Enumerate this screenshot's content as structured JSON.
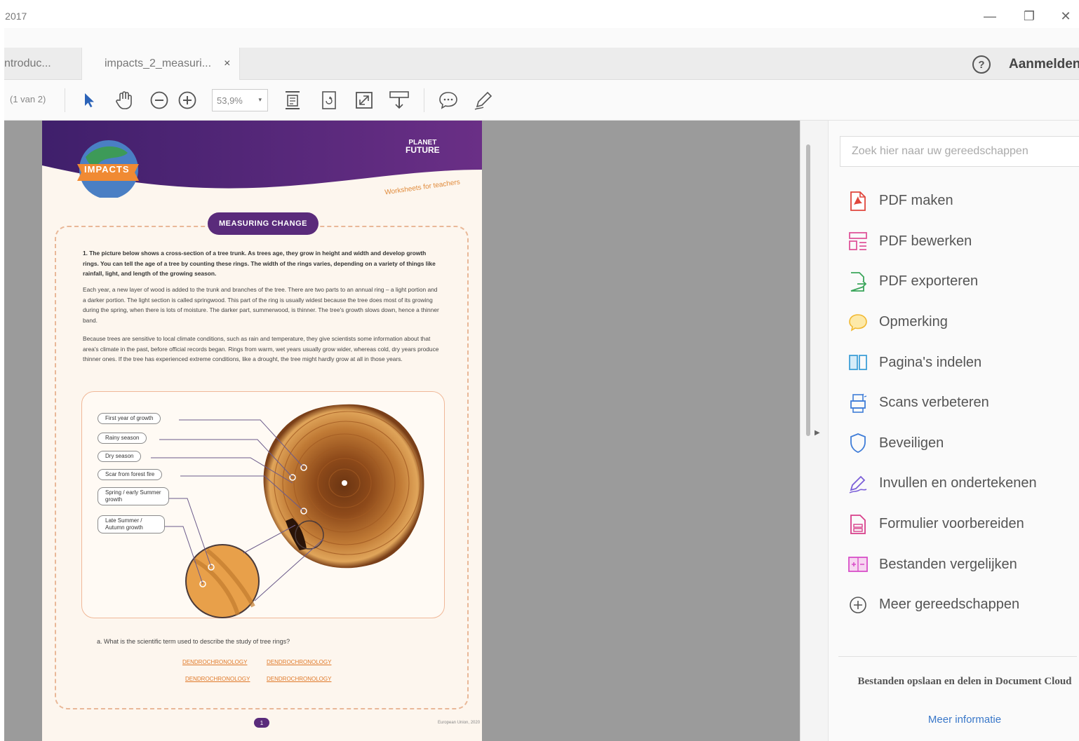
{
  "window": {
    "title": " 2017",
    "minimize": "—",
    "restore": "❐",
    "close": "✕"
  },
  "tabs": [
    {
      "label": "ntroduc..."
    },
    {
      "label": "impacts_2_measuri...",
      "close": "×"
    }
  ],
  "header": {
    "help": "?",
    "signin": "Aanmelden"
  },
  "toolbar": {
    "page_indicator": "(1 van 2)",
    "zoom": "53,9%",
    "zoom_caret": "▾"
  },
  "document": {
    "banner_label": "IMPACTS",
    "logo_line1": "PLANET",
    "logo_line2": "FUTURE",
    "worksheets_label": "Worksheets for teachers",
    "section_title": "MEASURING CHANGE",
    "paragraph1": "1. The picture below shows a cross-section of a tree trunk. As trees age, they grow in height and width and develop growth rings. You can tell the age of a tree by counting these rings. The width of the rings varies, depending on a variety of things like rainfall, light, and length of the growing season.",
    "paragraph2": "Each year, a new layer of wood is added to the trunk and branches of the tree. There are two parts to an annual ring – a light portion and a darker portion. The light section is called springwood. This part of the ring is usually widest because the tree does most of its growing during the spring, when there is lots of moisture. The darker part, summerwood, is thinner. The tree's growth slows down, hence a thinner band.",
    "paragraph3": "Because trees are sensitive to local climate conditions, such as rain and temperature, they give scientists some information about that area's climate in the past, before official records began. Rings from warm, wet years usually grow wider, whereas cold, dry years produce thinner ones. If the tree has experienced extreme conditions, like a drought, the tree might hardly grow at all in those years.",
    "labels": [
      "First year of growth",
      "Rainy season",
      "Dry season",
      "Scar from forest fire",
      "Spring / early Summer growth",
      "Late Summer / Autumn growth"
    ],
    "question": "a. What is the scientific term used to describe the study of tree rings?",
    "answers": [
      "DENDROCHRONOLOGY",
      "DENDROCHRONOLOGY",
      "DENDROCHRONOLOGY",
      "DENDROCHRONOLOGY"
    ],
    "page_number": "1",
    "footer": "European Union, 2020"
  },
  "rightpane": {
    "search_placeholder": "Zoek hier naar uw gereedschappen",
    "tools": [
      {
        "label": "PDF maken",
        "icon": "pdf-create-icon",
        "color": "#e0463c"
      },
      {
        "label": "PDF bewerken",
        "icon": "pdf-edit-icon",
        "color": "#e0559a"
      },
      {
        "label": "PDF exporteren",
        "icon": "pdf-export-icon",
        "color": "#3aa55a"
      },
      {
        "label": "Opmerking",
        "icon": "comment-icon",
        "color": "#f1b830"
      },
      {
        "label": "Pagina's indelen",
        "icon": "organize-pages-icon",
        "color": "#3fa0d8"
      },
      {
        "label": "Scans verbeteren",
        "icon": "enhance-scans-icon",
        "color": "#3f7dd8"
      },
      {
        "label": "Beveiligen",
        "icon": "shield-icon",
        "color": "#3f7dd8"
      },
      {
        "label": "Invullen en ondertekenen",
        "icon": "fill-sign-icon",
        "color": "#7b5ed8"
      },
      {
        "label": "Formulier voorbereiden",
        "icon": "prepare-form-icon",
        "color": "#d83f8a"
      },
      {
        "label": "Bestanden vergelijken",
        "icon": "compare-files-icon",
        "color": "#d84fc8"
      },
      {
        "label": "Meer gereedschappen",
        "icon": "plus-circle-icon",
        "color": "#555555"
      }
    ],
    "cloud_text": "Bestanden opslaan en delen in Document Cloud",
    "more_info": "Meer informatie"
  }
}
